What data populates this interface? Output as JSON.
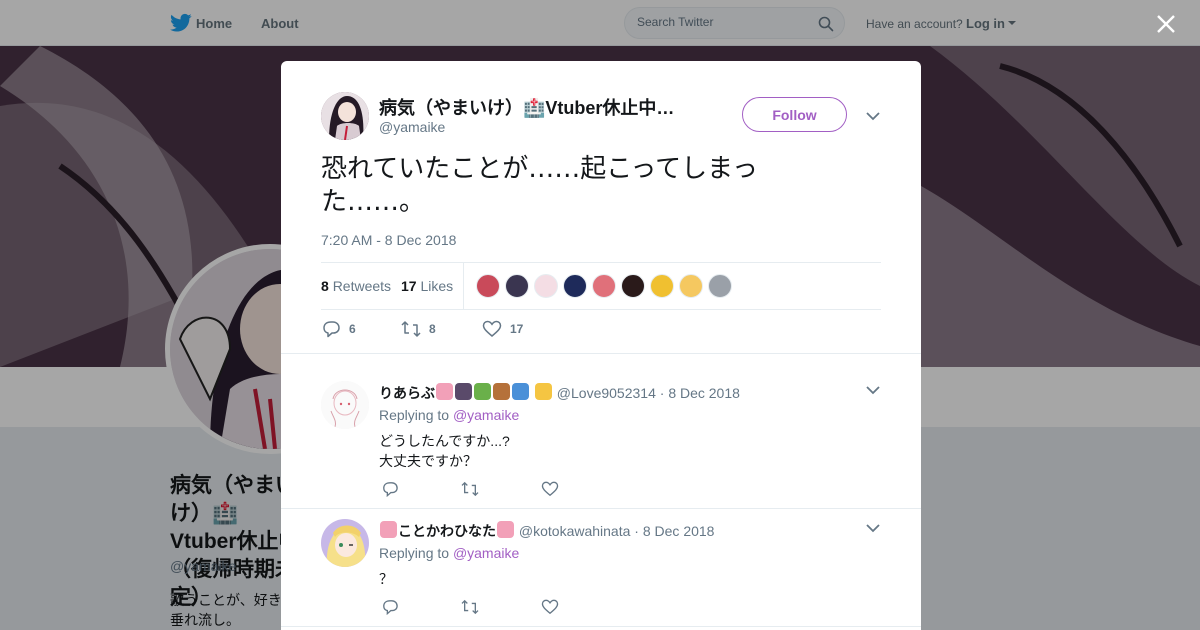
{
  "nav": {
    "home_label": "Home",
    "about_label": "About",
    "search_placeholder": "Search Twitter",
    "have_account": "Have an account?",
    "login_label": "Log in"
  },
  "background_profile": {
    "name": "病気（やまいけ）🏥Vtuber休止中（復帰時期未定）",
    "handle": "@yamaike",
    "bio": "歌うことが、好きで垂れ流し。"
  },
  "tweet": {
    "author_name": "病気（やまいけ）🏥Vtuber休止中…",
    "author_handle": "@yamaike",
    "follow_label": "Follow",
    "text": "恐れていたことが……起こってしまった……。",
    "timestamp": "7:20 AM - 8 Dec 2018",
    "retweets_count": "8",
    "retweets_label": "Retweets",
    "likes_count": "17",
    "likes_label": "Likes",
    "liker_colors": [
      "#c94a5a",
      "#3a3550",
      "#f4dde4",
      "#1e2a5a",
      "#e0707a",
      "#2a1a1a",
      "#f0c030",
      "#f5c860",
      "#9aa0a8"
    ],
    "reply_count": "6",
    "retweet_count_action": "8",
    "like_count_action": "17"
  },
  "replies": [
    {
      "name": "りあらぶ",
      "handle": "@Love9052314",
      "date": "8 Dec 2018",
      "replying_prefix": "Replying to",
      "replying_to": "@yamaike",
      "body": "どうしたんですか...?\n大丈夫ですか？"
    },
    {
      "name": "ことかわひなた",
      "handle": "@kotokawahinata",
      "date": "8 Dec 2018",
      "replying_prefix": "Replying to",
      "replying_to": "@yamaike",
      "body": "？"
    }
  ],
  "colors": {
    "accent": "#a25fc4",
    "twitter_blue": "#1da1f2",
    "muted": "#657786"
  }
}
